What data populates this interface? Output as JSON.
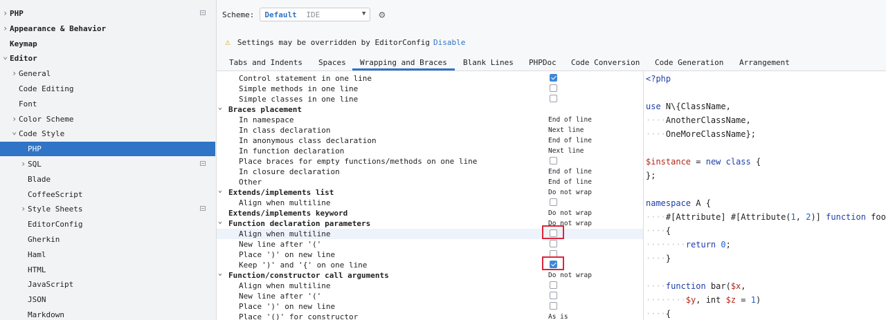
{
  "sidebar": {
    "items": [
      {
        "label": "PHP",
        "chevron": ">",
        "bold": true,
        "selected": false,
        "project": true
      },
      {
        "label": "Appearance & Behavior",
        "chevron": ">",
        "bold": true,
        "selected": false,
        "project": false
      },
      {
        "label": "Keymap",
        "chevron": "",
        "bold": true,
        "selected": false,
        "project": false
      },
      {
        "label": "Editor",
        "chevron": "v",
        "bold": true,
        "selected": false,
        "project": false
      },
      {
        "label": "General",
        "chevron": ">",
        "bold": false,
        "selected": false,
        "project": false
      },
      {
        "label": "Code Editing",
        "chevron": "",
        "bold": false,
        "selected": false,
        "project": false
      },
      {
        "label": "Font",
        "chevron": "",
        "bold": false,
        "selected": false,
        "project": false
      },
      {
        "label": "Color Scheme",
        "chevron": ">",
        "bold": false,
        "selected": false,
        "project": false
      },
      {
        "label": "Code Style",
        "chevron": "v",
        "bold": false,
        "selected": false,
        "project": false
      },
      {
        "label": "PHP",
        "chevron": "",
        "bold": false,
        "selected": true,
        "project": false
      },
      {
        "label": "SQL",
        "chevron": ">",
        "bold": false,
        "selected": false,
        "project": true
      },
      {
        "label": "Blade",
        "chevron": "",
        "bold": false,
        "selected": false,
        "project": false
      },
      {
        "label": "CoffeeScript",
        "chevron": "",
        "bold": false,
        "selected": false,
        "project": false
      },
      {
        "label": "Style Sheets",
        "chevron": ">",
        "bold": false,
        "selected": false,
        "project": true
      },
      {
        "label": "EditorConfig",
        "chevron": "",
        "bold": false,
        "selected": false,
        "project": false
      },
      {
        "label": "Gherkin",
        "chevron": "",
        "bold": false,
        "selected": false,
        "project": false
      },
      {
        "label": "Haml",
        "chevron": "",
        "bold": false,
        "selected": false,
        "project": false
      },
      {
        "label": "HTML",
        "chevron": "",
        "bold": false,
        "selected": false,
        "project": false
      },
      {
        "label": "JavaScript",
        "chevron": "",
        "bold": false,
        "selected": false,
        "project": false
      },
      {
        "label": "JSON",
        "chevron": "",
        "bold": false,
        "selected": false,
        "project": false
      },
      {
        "label": "Markdown",
        "chevron": "",
        "bold": false,
        "selected": false,
        "project": false
      }
    ]
  },
  "scheme": {
    "label": "Scheme:",
    "name": "Default",
    "sub": "IDE"
  },
  "notice": {
    "text": "Settings may be overridden by EditorConfig",
    "link": "Disable"
  },
  "tabs": [
    "Tabs and Indents",
    "Spaces",
    "Wrapping and Braces",
    "Blank Lines",
    "PHPDoc",
    "Code Conversion",
    "Code Generation",
    "Arrangement"
  ],
  "active_tab": "Wrapping and Braces",
  "settings": [
    {
      "label": "Control statement in one line",
      "group": false,
      "type": "check",
      "checked": true
    },
    {
      "label": "Simple methods in one line",
      "group": false,
      "type": "check",
      "checked": false
    },
    {
      "label": "Simple classes in one line",
      "group": false,
      "type": "check",
      "checked": false
    },
    {
      "label": "Braces placement",
      "group": true,
      "type": "none"
    },
    {
      "label": "In namespace",
      "group": false,
      "type": "value",
      "value": "End of line"
    },
    {
      "label": "In class declaration",
      "group": false,
      "type": "value",
      "value": "Next line"
    },
    {
      "label": "In anonymous class declaration",
      "group": false,
      "type": "value",
      "value": "End of line"
    },
    {
      "label": "In function declaration",
      "group": false,
      "type": "value",
      "value": "Next line"
    },
    {
      "label": "Place braces for empty functions/methods on one line",
      "group": false,
      "type": "check",
      "checked": false
    },
    {
      "label": "In closure declaration",
      "group": false,
      "type": "value",
      "value": "End of line"
    },
    {
      "label": "Other",
      "group": false,
      "type": "value",
      "value": "End of line"
    },
    {
      "label": "Extends/implements list",
      "group": true,
      "type": "value",
      "value": "Do not wrap"
    },
    {
      "label": "Align when multiline",
      "group": false,
      "type": "check",
      "checked": false
    },
    {
      "label": "Extends/implements keyword",
      "group": true,
      "chevron": false,
      "type": "value",
      "value": "Do not wrap"
    },
    {
      "label": "Function declaration parameters",
      "group": true,
      "type": "value",
      "value": "Do not wrap"
    },
    {
      "label": "Align when multiline",
      "group": false,
      "type": "check",
      "checked": false,
      "highlight": true,
      "marked": true
    },
    {
      "label": "New line after '('",
      "group": false,
      "type": "check",
      "checked": false
    },
    {
      "label": "Place ')' on new line",
      "group": false,
      "type": "check",
      "checked": false
    },
    {
      "label": "Keep ')' and '{' on one line",
      "group": false,
      "type": "check",
      "checked": true,
      "marked": true
    },
    {
      "label": "Function/constructor call arguments",
      "group": true,
      "type": "value",
      "value": "Do not wrap"
    },
    {
      "label": "Align when multiline",
      "group": false,
      "type": "check",
      "checked": false
    },
    {
      "label": "New line after '('",
      "group": false,
      "type": "check",
      "checked": false
    },
    {
      "label": "Place ')' on new line",
      "group": false,
      "type": "check",
      "checked": false
    },
    {
      "label": "Place '()' for constructor",
      "group": false,
      "type": "value",
      "value": "As is"
    }
  ],
  "preview_lines": [
    [
      {
        "t": "<?php",
        "c": "kw"
      }
    ],
    [],
    [
      {
        "t": "use ",
        "c": "kw"
      },
      {
        "t": "N\\{ClassName,"
      }
    ],
    [
      {
        "t": "····",
        "c": "ws"
      },
      {
        "t": "AnotherClassName,"
      }
    ],
    [
      {
        "t": "····",
        "c": "ws"
      },
      {
        "t": "OneMoreClassName};"
      }
    ],
    [],
    [
      {
        "t": "$instance",
        "c": "var"
      },
      {
        "t": " = "
      },
      {
        "t": "new class",
        "c": "kw"
      },
      {
        "t": " {"
      }
    ],
    [
      {
        "t": "};"
      }
    ],
    [],
    [
      {
        "t": "namespace",
        "c": "kw"
      },
      {
        "t": " A {"
      }
    ],
    [
      {
        "t": "····",
        "c": "ws"
      },
      {
        "t": "#[Attribute] #[Attribute("
      },
      {
        "t": "1",
        "c": "num"
      },
      {
        "t": ", "
      },
      {
        "t": "2",
        "c": "num"
      },
      {
        "t": ")] "
      },
      {
        "t": "function",
        "c": "kw"
      },
      {
        "t": " foo()"
      }
    ],
    [
      {
        "t": "····",
        "c": "ws"
      },
      {
        "t": "{"
      }
    ],
    [
      {
        "t": "········",
        "c": "ws"
      },
      {
        "t": "return ",
        "c": "kw"
      },
      {
        "t": "0",
        "c": "num"
      },
      {
        "t": ";"
      }
    ],
    [
      {
        "t": "····",
        "c": "ws"
      },
      {
        "t": "}"
      }
    ],
    [],
    [
      {
        "t": "····",
        "c": "ws"
      },
      {
        "t": "function",
        "c": "kw"
      },
      {
        "t": " bar("
      },
      {
        "t": "$x",
        "c": "var"
      },
      {
        "t": ","
      }
    ],
    [
      {
        "t": "········",
        "c": "ws"
      },
      {
        "t": "$y",
        "c": "var"
      },
      {
        "t": ", int "
      },
      {
        "t": "$z",
        "c": "var"
      },
      {
        "t": " = "
      },
      {
        "t": "1",
        "c": "num"
      },
      {
        "t": ")"
      }
    ],
    [
      {
        "t": "····",
        "c": "ws"
      },
      {
        "t": "{"
      }
    ]
  ],
  "colors": {
    "accent": "#2f74c6",
    "warning": "#e6a100",
    "marker": "#e0233a",
    "keyword": "#1d3ea8",
    "variable": "#b1271c",
    "number": "#1b5fd1"
  }
}
